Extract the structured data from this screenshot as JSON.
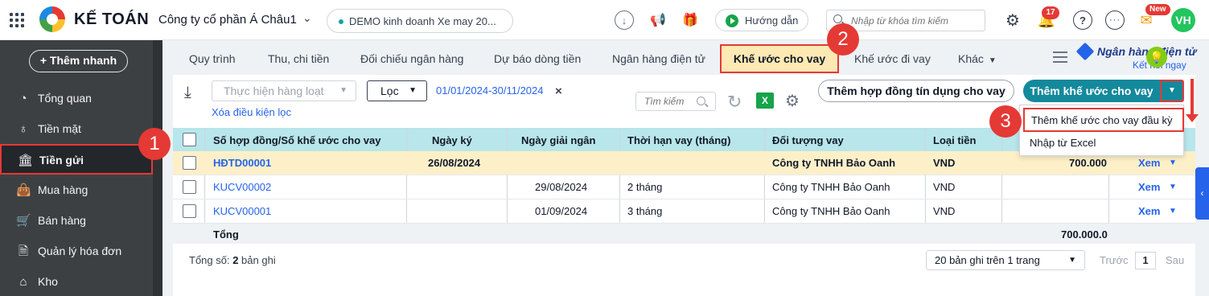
{
  "topbar": {
    "brand": "KẾ TOÁN",
    "company": "Công ty cổ phần Á Châu1",
    "demo": "DEMO kinh doanh Xe may 20...",
    "guide_label": "Hướng dẫn",
    "search_placeholder": "Nhập từ khóa tìm kiếm",
    "notifications": "17",
    "new_badge": "New",
    "avatar": "VH"
  },
  "sidebar": {
    "quick_add": "+ Thêm nhanh",
    "items": [
      {
        "label": "Tổng quan",
        "icon": "pie-chart-icon"
      },
      {
        "label": "Tiền mặt",
        "icon": "money-bag-icon"
      },
      {
        "label": "Tiền gửi",
        "icon": "bank-icon"
      },
      {
        "label": "Mua hàng",
        "icon": "shopping-bag-icon"
      },
      {
        "label": "Bán hàng",
        "icon": "cart-icon"
      },
      {
        "label": "Quản lý hóa đơn",
        "icon": "invoice-icon"
      },
      {
        "label": "Kho",
        "icon": "warehouse-icon"
      }
    ]
  },
  "tabs": {
    "items": [
      "Quy trình",
      "Thu, chi tiền",
      "Đối chiếu ngân hàng",
      "Dự báo dòng tiền",
      "Ngân hàng điện tử",
      "Khế ước cho vay",
      "Khế ước đi vay",
      "Khác"
    ],
    "bank_link": "Ngân hàng điện tử",
    "bank_connect": "Kết nối ngay"
  },
  "toolbar": {
    "bulk_action": "Thực hiện hàng loạt",
    "filter": "Lọc",
    "date_range": "01/01/2024-30/11/2024",
    "clear_filter": "Xóa điều kiện lọc",
    "search_placeholder": "Tìm kiếm",
    "credit_contract": "Thêm hợp đồng tín dụng cho vay",
    "add_loan": "Thêm khế ước cho vay"
  },
  "dropdown": {
    "items": [
      "Thêm khế ước cho vay đầu kỳ",
      "Nhập từ Excel"
    ]
  },
  "table": {
    "headers": [
      "Số hợp đồng/Số khế ước cho vay",
      "Ngày ký",
      "Ngày giải ngân",
      "Thời hạn vay (tháng)",
      "Đối tượng vay",
      "Loại tiền"
    ],
    "rows": [
      {
        "code": "HĐTD00001",
        "sign_date": "26/08/2024",
        "disburse_date": "",
        "term": "",
        "borrower": "Công ty TNHH Bảo Oanh",
        "currency": "VND",
        "amount": "700.000",
        "action": "Xem"
      },
      {
        "code": "KUCV00002",
        "sign_date": "",
        "disburse_date": "29/08/2024",
        "term": "2 tháng",
        "borrower": "Công ty TNHH Bảo Oanh",
        "currency": "VND",
        "amount": "",
        "action": "Xem"
      },
      {
        "code": "KUCV00001",
        "sign_date": "",
        "disburse_date": "01/09/2024",
        "term": "3 tháng",
        "borrower": "Công ty TNHH Bảo Oanh",
        "currency": "VND",
        "amount": "",
        "action": "Xem"
      }
    ],
    "total_label": "Tổng",
    "total_value": "700.000.0"
  },
  "footer": {
    "count_prefix": "Tổng số: ",
    "count": "2",
    "count_suffix": " bản ghi",
    "page_size": "20 bản ghi trên 1 trang",
    "prev": "Trước",
    "page": "1",
    "next": "Sau"
  },
  "steps": [
    "1",
    "2",
    "3"
  ],
  "colors": {
    "accent": "#14899c",
    "sidebar": "#3d4043",
    "marker": "#e53935",
    "header_row": "#b8e6ea",
    "highlight_row": "#fdf0c8"
  }
}
